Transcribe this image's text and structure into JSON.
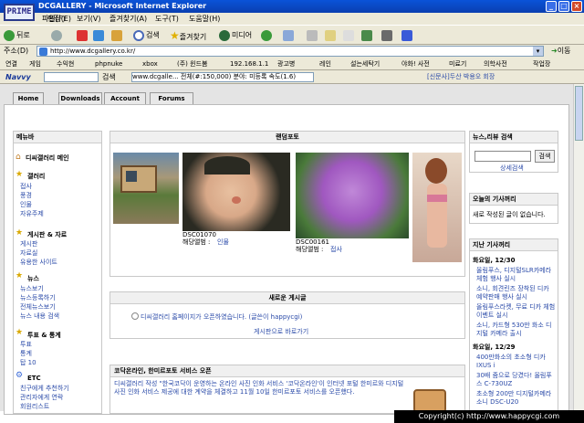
{
  "window": {
    "title": "DCGALLERY - Microsoft Internet Explorer",
    "prime_badge": "PRIME"
  },
  "menu": [
    "파일(F)",
    "편집(E)",
    "보기(V)",
    "즐겨찾기(A)",
    "도구(T)",
    "도움말(H)"
  ],
  "toolbar": {
    "back": "뒤로",
    "search": "검색",
    "favorites": "즐겨찾기",
    "media": "미디어"
  },
  "address": {
    "label": "주소(D)",
    "url": "http://www.dcgallery.co.kr/",
    "go": "이동"
  },
  "links": {
    "label": "연결",
    "items": [
      "게임",
      "수익현",
      "phpnuke",
      "xbox",
      "(주) 윈드봄",
      "192.168.1.1",
      "광고병",
      "레인",
      "설는세탁기",
      "야화! 사전",
      "미료기",
      "의학사전",
      "작업장"
    ]
  },
  "navy": {
    "brand": "Navvy",
    "search": "검색",
    "ticker": "www.dcgalle... 전체(#:150,000) 분야: 미등록 속도(1.6)",
    "news": "[신문사]두산 박용오 회장"
  },
  "tabs": [
    "Home",
    "Downloads",
    "Account",
    "Forums"
  ],
  "left": {
    "title": "메뉴바",
    "home": "디씨갤러리 메인",
    "cats": [
      {
        "name": "갤러리",
        "subs": [
          "접사",
          "풍경",
          "인물",
          "자유주제"
        ]
      },
      {
        "name": "게시판 & 자료",
        "subs": [
          "게시판",
          "자료실",
          "유용한 사이트"
        ]
      },
      {
        "name": "뉴스",
        "subs": [
          "뉴스보기",
          "뉴스등록하기",
          "전체뉴스보기",
          "뉴스 내용 검색"
        ]
      },
      {
        "name": "투표 & 통계",
        "subs": [
          "투표",
          "통계",
          "탑 10"
        ]
      },
      {
        "name": "ETC",
        "subs": [
          "친구에게 추천하기",
          "관리자에게 연락",
          "회원리스트"
        ]
      }
    ]
  },
  "random": {
    "title": "랜덤포토",
    "photo1": {
      "code": "DSC01070",
      "album_label": "해당앨범 :",
      "album": "인물"
    },
    "photo2": {
      "code": "DSC00161",
      "album_label": "해당앨범 :",
      "album": "접사"
    }
  },
  "board": {
    "title": "새로운 게시글",
    "post": "디씨갤러리 홈페이지가 오픈하였습니다. (글쓴이 happycgi)",
    "link": "게시판으로 바로가기"
  },
  "news": {
    "title": "코닥온라인, 한미르포토 서비스 오픈",
    "body": "디씨갤러리 작성 \"한국코닥이 운영하는 온라인 사진 인화 서비스 '코닥온라인'이 인터넷 포털 한미르와 디지털 사진 인화 서비스 제공에 대한 계약을 체결하고 11월 10일 한미르포토 서비스를 오픈했다."
  },
  "right": {
    "search": {
      "title": "뉴스,리뷰 검색",
      "button": "검색",
      "detail": "상세검색"
    },
    "today": {
      "title": "오늘의 기사꺼리",
      "text": "새로 작성된 글이 없습니다."
    },
    "past": {
      "title": "지난 기사꺼리",
      "groups": [
        {
          "date": "화요일, 12/30",
          "items": [
            "올림푸스, 디지털SLR카메라 체험 행사 실시",
            "소니, 회견린즈 장착된 디카 예약판매 행사 실시",
            "올림푸스라켓, 무료 디카 체험 이벤트 실시",
            "소니, 카드형 530만 화소 디지털 카메라 출시"
          ]
        },
        {
          "date": "화요일, 12/29",
          "items": [
            "400만화소의 초소형 디카 IXUS i",
            "30배 줌으로 당겼다! 올림푸스 C-730UZ",
            "초소형 200만 디지털카메라 소니 DSC-U20"
          ]
        }
      ]
    }
  },
  "copyright": "Copyright(c) http://www.happycgi.com"
}
